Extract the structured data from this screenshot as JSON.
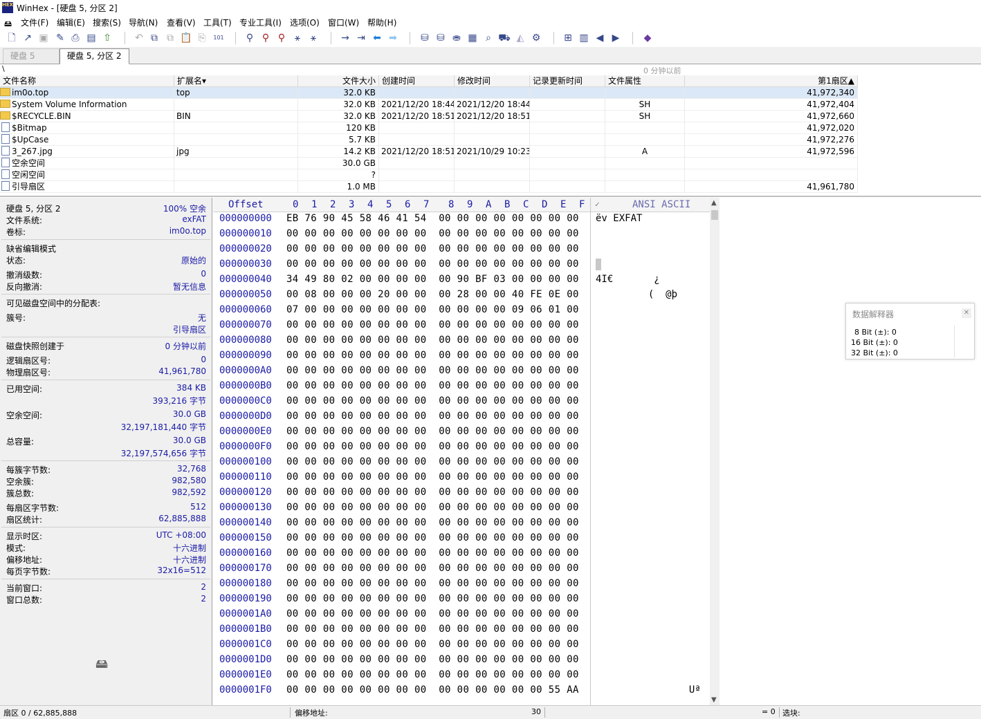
{
  "window": {
    "title": "WinHex - [硬盘 5, 分区 2]",
    "logo_text": "HEX"
  },
  "menu": [
    "文件(F)",
    "编辑(E)",
    "搜索(S)",
    "导航(N)",
    "查看(V)",
    "工具(T)",
    "专业工具(I)",
    "选项(O)",
    "窗口(W)",
    "帮助(H)"
  ],
  "tabs": [
    {
      "label": "硬盘 5",
      "active": false
    },
    {
      "label": "硬盘 5, 分区 2",
      "active": true
    }
  ],
  "pathbar": {
    "path": "\\",
    "updated": "0 分钟以前"
  },
  "filelist": {
    "columns": [
      "文件名称",
      "扩展名▾",
      "文件大小",
      "创建时间",
      "修改时间",
      "记录更新时间",
      "文件属性",
      "第1扇区▲"
    ],
    "rows": [
      {
        "name": "im0o.top",
        "ext": "top",
        "size": "32.0 KB",
        "created": "",
        "modified": "",
        "updated": "",
        "attr": "",
        "sector": "41,972,340",
        "icon": "folder",
        "selected": true
      },
      {
        "name": "System Volume Information",
        "ext": "",
        "size": "32.0 KB",
        "created": "2021/12/20   18:44:...",
        "modified": "2021/12/20   18:44:...",
        "updated": "",
        "attr": "SH",
        "sector": "41,972,404",
        "icon": "folder",
        "selected": false
      },
      {
        "name": "$RECYCLE.BIN",
        "ext": "BIN",
        "size": "32.0 KB",
        "created": "2021/12/20   18:51:...",
        "modified": "2021/12/20   18:51:...",
        "updated": "",
        "attr": "SH",
        "sector": "41,972,660",
        "icon": "folder",
        "selected": false
      },
      {
        "name": "$Bitmap",
        "ext": "",
        "size": "120 KB",
        "created": "",
        "modified": "",
        "updated": "",
        "attr": "",
        "sector": "41,972,020",
        "icon": "file",
        "selected": false
      },
      {
        "name": "$UpCase",
        "ext": "",
        "size": "5.7 KB",
        "created": "",
        "modified": "",
        "updated": "",
        "attr": "",
        "sector": "41,972,276",
        "icon": "file",
        "selected": false
      },
      {
        "name": "3_267.jpg",
        "ext": "jpg",
        "size": "14.2 KB",
        "created": "2021/12/20   18:51:...",
        "modified": "2021/10/29   10:23:...",
        "updated": "",
        "attr": "A",
        "sector": "41,972,596",
        "icon": "file",
        "selected": false
      },
      {
        "name": "空余空间",
        "ext": "",
        "size": "30.0 GB",
        "created": "",
        "modified": "",
        "updated": "",
        "attr": "",
        "sector": "",
        "icon": "file",
        "selected": false
      },
      {
        "name": "空闲空间",
        "ext": "",
        "size": "?",
        "created": "",
        "modified": "",
        "updated": "",
        "attr": "",
        "sector": "",
        "icon": "file",
        "selected": false
      },
      {
        "name": "引导扇区",
        "ext": "",
        "size": "1.0 MB",
        "created": "",
        "modified": "",
        "updated": "",
        "attr": "",
        "sector": "41,961,780",
        "icon": "file",
        "selected": false
      }
    ]
  },
  "info": {
    "groups": [
      [
        {
          "l": "硬盘 5, 分区 2",
          "r": "100% 空余"
        },
        {
          "l": "文件系统:",
          "r": "exFAT"
        },
        {
          "l": "卷标:",
          "r": "im0o.top"
        }
      ],
      [
        {
          "l": "缺省编辑模式",
          "r": ""
        },
        {
          "l": "状态:",
          "r": "原始的"
        }
      ],
      [
        {
          "l": "撤消级数:",
          "r": "0"
        },
        {
          "l": "反向撤消:",
          "r": "暂无信息"
        }
      ],
      [
        {
          "l": "可见磁盘空间中的分配表:",
          "r": ""
        }
      ],
      [
        {
          "l": "簇号:",
          "r": "无"
        },
        {
          "l": "",
          "r": "引导扇区"
        }
      ],
      [
        {
          "l": "磁盘快照创建于",
          "r": "0 分钟以前"
        }
      ],
      [
        {
          "l": "逻辑扇区号:",
          "r": "0"
        },
        {
          "l": "物理扇区号:",
          "r": "41,961,780"
        }
      ],
      [
        {
          "l": "已用空间:",
          "r": "384 KB"
        },
        {
          "l": "",
          "r": "393,216 字节"
        }
      ],
      [
        {
          "l": "空余空间:",
          "r": "30.0 GB"
        },
        {
          "l": "",
          "r": "32,197,181,440 字节"
        }
      ],
      [
        {
          "l": "总容量:",
          "r": "30.0 GB"
        },
        {
          "l": "",
          "r": "32,197,574,656 字节"
        }
      ],
      [
        {
          "l": "每簇字节数:",
          "r": "32,768"
        },
        {
          "l": "空余簇:",
          "r": "982,580"
        },
        {
          "l": "簇总数:",
          "r": "982,592"
        }
      ],
      [
        {
          "l": "每扇区字节数:",
          "r": "512"
        },
        {
          "l": "扇区统计:",
          "r": "62,885,888"
        }
      ],
      [
        {
          "l": "显示时区:",
          "r": "UTC +08:00"
        },
        {
          "l": "模式:",
          "r": "十六进制"
        },
        {
          "l": "偏移地址:",
          "r": "十六进制"
        },
        {
          "l": "每页字节数:",
          "r": "32x16=512"
        }
      ],
      [
        {
          "l": "当前窗口:",
          "r": "2"
        },
        {
          "l": "窗口总数:",
          "r": "2"
        }
      ]
    ]
  },
  "hex": {
    "header_offset": "Offset",
    "header_cols": [
      "0",
      "1",
      "2",
      "3",
      "4",
      "5",
      "6",
      "7",
      "8",
      "9",
      "A",
      "B",
      "C",
      "D",
      "E",
      "F"
    ],
    "header_charset": "ANSI ASCII",
    "rows": [
      {
        "off": "000000000",
        "bytes": "EB 76 90 45 58 46 41 54  00 00 00 00 00 00 00 00",
        "ascii": "ëv EXFAT"
      },
      {
        "off": "000000010",
        "bytes": "00 00 00 00 00 00 00 00  00 00 00 00 00 00 00 00",
        "ascii": ""
      },
      {
        "off": "000000020",
        "bytes": "00 00 00 00 00 00 00 00  00 00 00 00 00 00 00 00",
        "ascii": ""
      },
      {
        "off": "000000030",
        "bytes": "00 00 00 00 00 00 00 00  00 00 00 00 00 00 00 00",
        "ascii": ""
      },
      {
        "off": "000000040",
        "bytes": "34 49 80 02 00 00 00 00  00 90 BF 03 00 00 00 00",
        "ascii": "4I€       ¿"
      },
      {
        "off": "000000050",
        "bytes": "00 08 00 00 00 20 00 00  00 28 00 00 40 FE 0E 00",
        "ascii": "         (  @þ"
      },
      {
        "off": "000000060",
        "bytes": "07 00 00 00 00 00 00 00  00 00 00 00 09 06 01 00",
        "ascii": ""
      },
      {
        "off": "000000070",
        "bytes": "00 00 00 00 00 00 00 00  00 00 00 00 00 00 00 00",
        "ascii": ""
      },
      {
        "off": "000000080",
        "bytes": "00 00 00 00 00 00 00 00  00 00 00 00 00 00 00 00",
        "ascii": ""
      },
      {
        "off": "000000090",
        "bytes": "00 00 00 00 00 00 00 00  00 00 00 00 00 00 00 00",
        "ascii": ""
      },
      {
        "off": "0000000A0",
        "bytes": "00 00 00 00 00 00 00 00  00 00 00 00 00 00 00 00",
        "ascii": ""
      },
      {
        "off": "0000000B0",
        "bytes": "00 00 00 00 00 00 00 00  00 00 00 00 00 00 00 00",
        "ascii": ""
      },
      {
        "off": "0000000C0",
        "bytes": "00 00 00 00 00 00 00 00  00 00 00 00 00 00 00 00",
        "ascii": ""
      },
      {
        "off": "0000000D0",
        "bytes": "00 00 00 00 00 00 00 00  00 00 00 00 00 00 00 00",
        "ascii": ""
      },
      {
        "off": "0000000E0",
        "bytes": "00 00 00 00 00 00 00 00  00 00 00 00 00 00 00 00",
        "ascii": ""
      },
      {
        "off": "0000000F0",
        "bytes": "00 00 00 00 00 00 00 00  00 00 00 00 00 00 00 00",
        "ascii": ""
      },
      {
        "off": "000000100",
        "bytes": "00 00 00 00 00 00 00 00  00 00 00 00 00 00 00 00",
        "ascii": ""
      },
      {
        "off": "000000110",
        "bytes": "00 00 00 00 00 00 00 00  00 00 00 00 00 00 00 00",
        "ascii": ""
      },
      {
        "off": "000000120",
        "bytes": "00 00 00 00 00 00 00 00  00 00 00 00 00 00 00 00",
        "ascii": ""
      },
      {
        "off": "000000130",
        "bytes": "00 00 00 00 00 00 00 00  00 00 00 00 00 00 00 00",
        "ascii": ""
      },
      {
        "off": "000000140",
        "bytes": "00 00 00 00 00 00 00 00  00 00 00 00 00 00 00 00",
        "ascii": ""
      },
      {
        "off": "000000150",
        "bytes": "00 00 00 00 00 00 00 00  00 00 00 00 00 00 00 00",
        "ascii": ""
      },
      {
        "off": "000000160",
        "bytes": "00 00 00 00 00 00 00 00  00 00 00 00 00 00 00 00",
        "ascii": ""
      },
      {
        "off": "000000170",
        "bytes": "00 00 00 00 00 00 00 00  00 00 00 00 00 00 00 00",
        "ascii": ""
      },
      {
        "off": "000000180",
        "bytes": "00 00 00 00 00 00 00 00  00 00 00 00 00 00 00 00",
        "ascii": ""
      },
      {
        "off": "000000190",
        "bytes": "00 00 00 00 00 00 00 00  00 00 00 00 00 00 00 00",
        "ascii": ""
      },
      {
        "off": "0000001A0",
        "bytes": "00 00 00 00 00 00 00 00  00 00 00 00 00 00 00 00",
        "ascii": ""
      },
      {
        "off": "0000001B0",
        "bytes": "00 00 00 00 00 00 00 00  00 00 00 00 00 00 00 00",
        "ascii": ""
      },
      {
        "off": "0000001C0",
        "bytes": "00 00 00 00 00 00 00 00  00 00 00 00 00 00 00 00",
        "ascii": ""
      },
      {
        "off": "0000001D0",
        "bytes": "00 00 00 00 00 00 00 00  00 00 00 00 00 00 00 00",
        "ascii": ""
      },
      {
        "off": "0000001E0",
        "bytes": "00 00 00 00 00 00 00 00  00 00 00 00 00 00 00 00",
        "ascii": ""
      },
      {
        "off": "0000001F0",
        "bytes": "00 00 00 00 00 00 00 00  00 00 00 00 00 00 55 AA",
        "ascii": "                Uª"
      }
    ]
  },
  "interpreter": {
    "title": "数据解释器",
    "rows": [
      "8 Bit (±): 0",
      "16 Bit (±): 0",
      "32 Bit (±): 0"
    ]
  },
  "status": {
    "sector": "扇区 0 / 62,885,888",
    "offset_label": "偏移地址:",
    "offset_value": "30",
    "eq": "= 0",
    "selection": "选块:"
  },
  "colors": {
    "accent": "#1a1aa6",
    "selected_row": "#dbe8f7",
    "panel_bg": "#f0f0f0"
  }
}
